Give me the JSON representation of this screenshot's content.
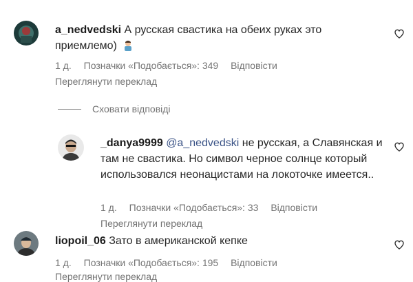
{
  "comments": [
    {
      "username": "a_nedvedski",
      "text": "А русская свастика на обеих руках это приемлемо)",
      "time": "1 д.",
      "likes": "Позначки «Подобається»: 349",
      "reply": "Відповісти",
      "translate": "Переглянути переклад"
    },
    {
      "username": "_danya9999",
      "mention": "@a_nedvedski",
      "text": " не русская, а Славянская и там не свастика. Но символ черное солнце который использовался неонацистами на локоточке имеется..",
      "time": "1 д.",
      "likes": "Позначки «Подобається»: 33",
      "reply": "Відповісти",
      "translate": "Переглянути переклад"
    },
    {
      "username": "liopoil_06",
      "text": "Зато в американской кепке",
      "time": "1 д.",
      "likes": "Позначки «Подобається»: 195",
      "reply": "Відповісти",
      "translate": "Переглянути переклад"
    }
  ],
  "hide_replies": "Сховати відповіді",
  "icons": {
    "like": "heart-outline-icon",
    "emoji": "person-shrugging-emoji"
  }
}
